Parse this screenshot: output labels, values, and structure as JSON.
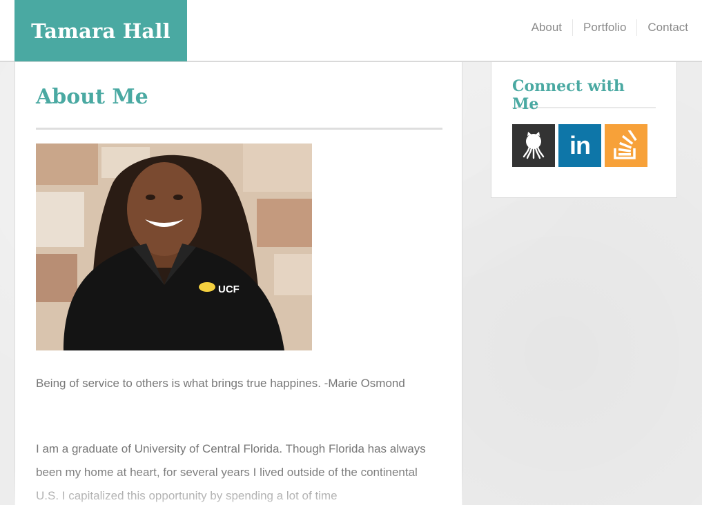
{
  "header": {
    "brand": "Tamara Hall",
    "nav": [
      {
        "label": "About"
      },
      {
        "label": "Portfolio"
      },
      {
        "label": "Contact"
      }
    ]
  },
  "main": {
    "title": "About Me",
    "photo_shirt_logo": "UCF",
    "quote": "Being of service to others is what brings true happines. -Marie Osmond",
    "bio": "I am a graduate of University of Central Florida. Though Florida has always been my home at heart, for several years I lived outside of the continental U.S. I capitalized this opportunity by spending a lot of time"
  },
  "sidebar": {
    "title": "Connect with Me",
    "social": [
      {
        "icon": "github-icon",
        "color": "#333333"
      },
      {
        "icon": "linkedin-icon",
        "color": "#0e76a8",
        "text": "in"
      },
      {
        "icon": "stackoverflow-icon",
        "color": "#f7a139"
      }
    ]
  },
  "colors": {
    "accent": "#4aa9a2",
    "text": "#777777",
    "background": "#ededed"
  }
}
